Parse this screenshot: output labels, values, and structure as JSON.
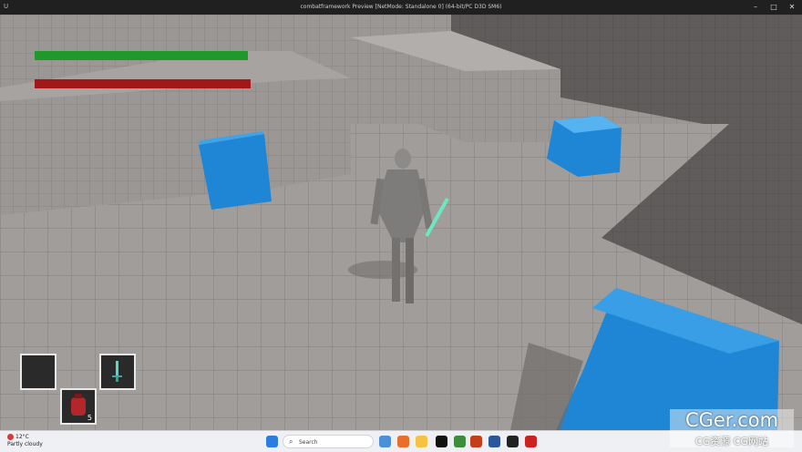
{
  "window": {
    "title": "combatframework Preview [NetMode: Standalone 0]  (64-bit/PC D3D SM6)",
    "app_icon": "unreal-icon",
    "buttons": [
      "minimize",
      "maximize",
      "close"
    ]
  },
  "hud": {
    "health_bar": {
      "color": "#1f9a2a",
      "fraction": 1.0
    },
    "stamina_bar": {
      "color": "#a01818",
      "fraction": 1.0
    },
    "inventory": {
      "slots": [
        {
          "item": "empty",
          "count": ""
        },
        {
          "item": "sword-icon",
          "count": ""
        },
        {
          "item": "potion-icon",
          "count": "5"
        }
      ]
    }
  },
  "scene": {
    "character": "mannequin-icon",
    "weapon": "glowing-sword",
    "cube_color": "#1f86d6"
  },
  "taskbar": {
    "weather_temp": "12°C",
    "weather_desc": "Partly cloudy",
    "search_placeholder": "Search"
  },
  "watermark": {
    "big": "CGer.com",
    "small": "CG资源 CG网站"
  }
}
